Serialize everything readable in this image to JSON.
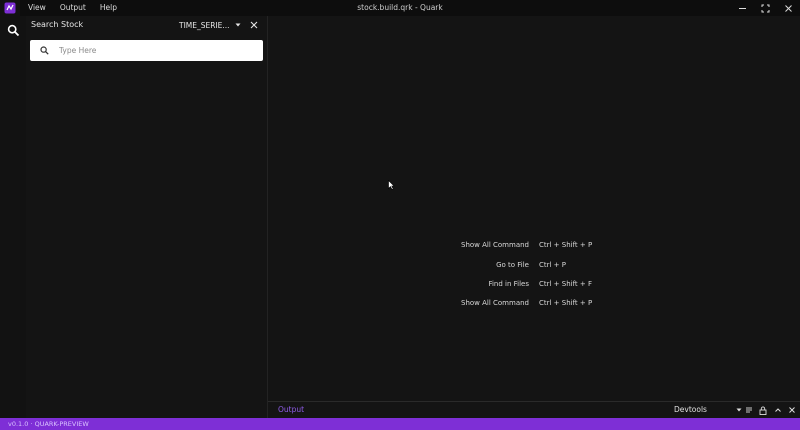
{
  "titlebar": {
    "menu": [
      "View",
      "Output",
      "Help"
    ],
    "window_title": "stock.build.qrk - Quark"
  },
  "sidepanel": {
    "title": "Search Stock",
    "series_selected": "TIME_SERIE...",
    "search_placeholder": "Type Here"
  },
  "editor": {
    "shortcuts": [
      {
        "label": "Show All Command",
        "keys": "Ctrl + Shift + P"
      },
      {
        "label": "Go to File",
        "keys": "Ctrl + P"
      },
      {
        "label": "Find in Files",
        "keys": "Ctrl + Shift + F"
      },
      {
        "label": "Show All Command",
        "keys": "Ctrl + Shift + P"
      }
    ]
  },
  "bottombar": {
    "output_tab": "Output",
    "devtools_selected": "Devtools"
  },
  "statusbar": {
    "text": "v0.1.0 · QUARK-PREVIEW"
  },
  "colors": {
    "accent": "#7e2fd6",
    "output_tab": "#8f5ce8",
    "background": "#141414"
  }
}
